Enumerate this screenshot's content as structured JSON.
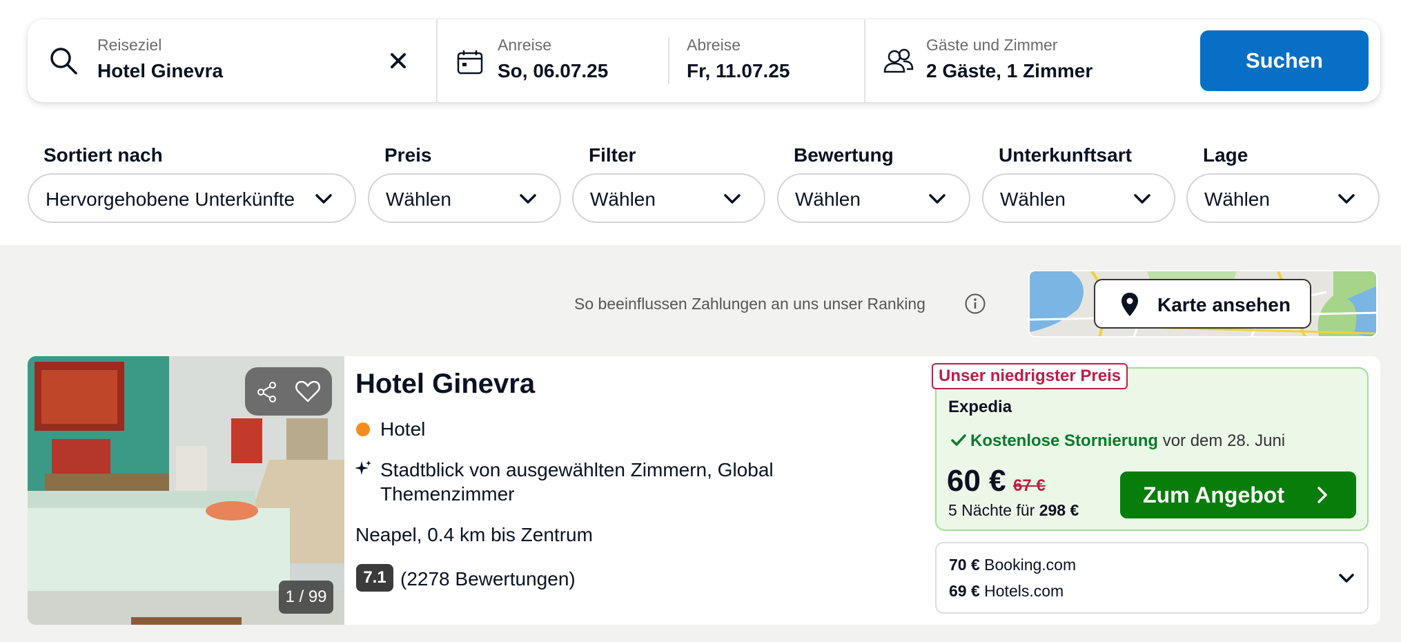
{
  "search": {
    "destination_label": "Reiseziel",
    "destination_value": "Hotel Ginevra",
    "checkin_label": "Anreise",
    "checkin_value": "So, 06.07.25",
    "checkout_label": "Abreise",
    "checkout_value": "Fr, 11.07.25",
    "guests_label": "Gäste und Zimmer",
    "guests_value": "2 Gäste, 1 Zimmer",
    "search_button": "Suchen"
  },
  "filters": [
    {
      "title": "Sortiert nach",
      "value": "Hervorgehobene Unterkünfte"
    },
    {
      "title": "Preis",
      "value": "Wählen"
    },
    {
      "title": "Filter",
      "value": "Wählen"
    },
    {
      "title": "Bewertung",
      "value": "Wählen"
    },
    {
      "title": "Unterkunftsart",
      "value": "Wählen"
    },
    {
      "title": "Lage",
      "value": "Wählen"
    }
  ],
  "ranking_note": "So beeinflussen Zahlungen an uns unser Ranking",
  "map_button": "Karte ansehen",
  "hotel": {
    "photo_counter": "1 / 99",
    "name": "Hotel Ginevra",
    "type": "Hotel",
    "feature": "Stadtblick von ausgewählten Zimmern, Global Themenzimmer",
    "location": "Neapel, 0.4 km bis Zentrum",
    "rating": "7.1",
    "reviews": "(2278 Bewertungen)",
    "deal": {
      "badge": "Unser niedrigster Preis",
      "provider": "Expedia",
      "cancel_bold": "Kostenlose Stornierung",
      "cancel_rest": "vor dem 28. Juni",
      "price": "60 €",
      "old_price": "67 €",
      "nights_text": "5 Nächte für",
      "nights_total": "298 €",
      "button": "Zum Angebot"
    },
    "other_offers": [
      {
        "price": "70 €",
        "provider": "Booking.com"
      },
      {
        "price": "69 €",
        "provider": "Hotels.com"
      }
    ]
  },
  "colors": {
    "primary_blue": "#0770c6",
    "deal_green": "#077d0a",
    "deal_bg": "#ebf8e8",
    "badge_red": "#c11b45",
    "hotel_type_dot": "#f68c1f"
  },
  "icons": [
    "search-icon",
    "close-icon",
    "calendar-icon",
    "users-icon",
    "chevron-down-icon",
    "info-icon",
    "map-pin-icon",
    "share-icon",
    "heart-icon",
    "sparkle-icon",
    "check-icon",
    "chevron-right-icon"
  ]
}
